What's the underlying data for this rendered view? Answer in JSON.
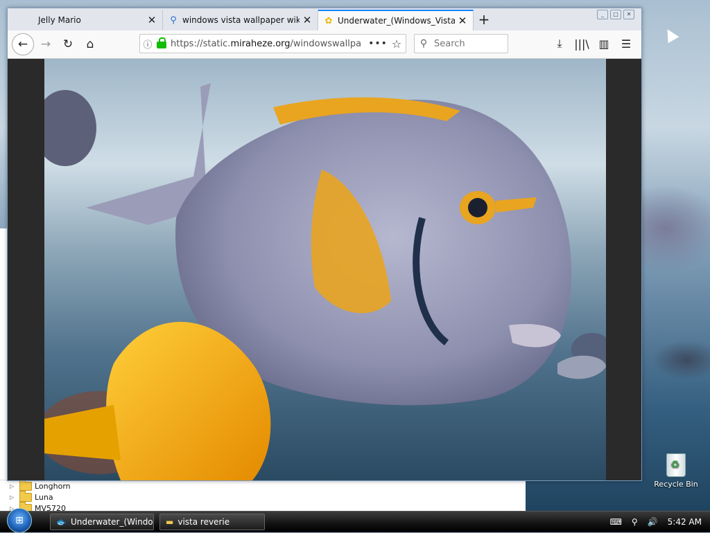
{
  "browser": {
    "tabs": [
      {
        "title": "Jelly Mario",
        "active": false
      },
      {
        "title": "windows vista wallpaper wiki - Sea",
        "active": false
      },
      {
        "title": "Underwater_(Windows_Vista_Buil",
        "active": true
      }
    ],
    "url_prefix": "https://static.",
    "url_domain": "miraheze.org",
    "url_rest": "/windowswallpa",
    "search_placeholder": "Search"
  },
  "explorer": {
    "tree": [
      "Longhorn",
      "Luna",
      "MV5720"
    ]
  },
  "desktop": {
    "recycle_bin_label": "Recycle Bin"
  },
  "taskbar": {
    "buttons": [
      "Underwater_(Window...",
      "vista reverie"
    ],
    "clock": "5:42 AM"
  },
  "colors": {
    "accent": "#0a84ff",
    "lock_green": "#12bc00",
    "fish_orange": "#e9a420",
    "fish_gray": "#9a9cb8"
  }
}
